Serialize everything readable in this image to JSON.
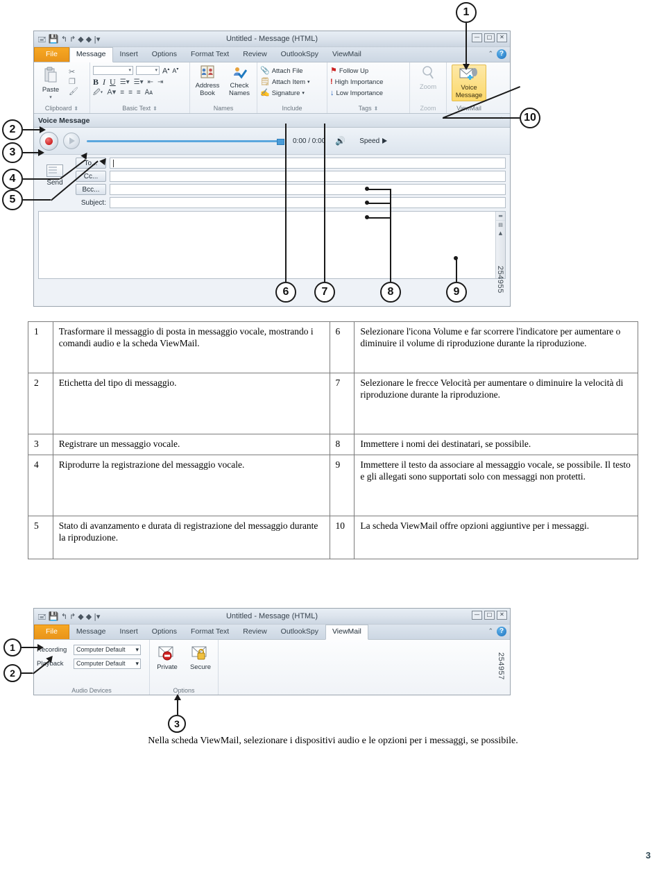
{
  "figure_top": {
    "window_title": "Untitled  -  Message (HTML)",
    "figure_id": "254955",
    "window_buttons": [
      "—",
      "□",
      "✕"
    ],
    "tabs": [
      {
        "label": "File",
        "kind": "file"
      },
      {
        "label": "Message",
        "kind": "active"
      },
      {
        "label": "Insert",
        "kind": "normal"
      },
      {
        "label": "Options",
        "kind": "normal"
      },
      {
        "label": "Format Text",
        "kind": "normal"
      },
      {
        "label": "Review",
        "kind": "normal"
      },
      {
        "label": "OutlookSpy",
        "kind": "normal"
      },
      {
        "label": "ViewMail",
        "kind": "normal"
      }
    ],
    "ribbon_groups": [
      {
        "label": "Clipboard",
        "dialog_launcher": true,
        "paste_label": "Paste"
      },
      {
        "label": "Basic Text",
        "dialog_launcher": true,
        "buttons": [
          "B",
          "I",
          "U"
        ]
      },
      {
        "label": "Names",
        "dialog_launcher": false,
        "items": [
          "Address Book",
          "Check Names"
        ]
      },
      {
        "label": "Include",
        "dialog_launcher": false,
        "items": [
          "Attach File",
          "Attach Item",
          "Signature"
        ]
      },
      {
        "label": "Tags",
        "dialog_launcher": true,
        "items": [
          "Follow Up",
          "High Importance",
          "Low Importance"
        ]
      },
      {
        "label": "Zoom",
        "dialog_launcher": false,
        "items": [
          "Zoom"
        ]
      },
      {
        "label": "ViewMail",
        "dialog_launcher": false,
        "items": [
          "Voice Message"
        ]
      }
    ],
    "voice_bar": {
      "title": "Voice Message",
      "collapse_icon": "chevron-double-up",
      "time": "0:00 / 0:00",
      "speed_label": "Speed"
    },
    "compose": {
      "send_label": "Send",
      "to_label": "To...",
      "cc_label": "Cc...",
      "bcc_label": "Bcc...",
      "subject_label": "Subject:",
      "to_value": "",
      "cc_value": "",
      "bcc_value": "",
      "subject_value": ""
    },
    "callouts": [
      "1",
      "2",
      "3",
      "4",
      "5",
      "6",
      "7",
      "8",
      "9",
      "10"
    ]
  },
  "reference_table": {
    "rows": [
      {
        "left_num": "1",
        "left_text": "Trasformare il messaggio di posta in messaggio vocale, mostrando i comandi audio e la scheda ViewMail.",
        "right_num": "6",
        "right_text": "Selezionare l'icona Volume e far scorrere l'indicatore per aumentare o diminuire il volume di riproduzione durante la riproduzione."
      },
      {
        "left_num": "2",
        "left_text": "Etichetta del tipo di messaggio.",
        "right_num": "7",
        "right_text": "Selezionare le frecce Velocità per aumentare o diminuire la velocità di riproduzione durante la riproduzione."
      },
      {
        "left_num": "3",
        "left_text": "Registrare un messaggio vocale.",
        "right_num": "8",
        "right_text": "Immettere i nomi dei destinatari, se possibile."
      },
      {
        "left_num": "4",
        "left_text": "Riprodurre la registrazione del messaggio vocale.",
        "right_num": "9",
        "right_text": "Immettere il testo da associare al messaggio vocale, se possibile. Il testo e gli allegati sono supportati solo con messaggi non protetti."
      },
      {
        "left_num": "5",
        "left_text": "Stato di avanzamento e durata di registrazione del messaggio durante la riproduzione.",
        "right_num": "10",
        "right_text": "La scheda ViewMail offre opzioni aggiuntive per i messaggi."
      }
    ]
  },
  "figure_bottom": {
    "window_title": "Untitled  -  Message (HTML)",
    "figure_id": "254957",
    "tabs": [
      {
        "label": "File",
        "kind": "file"
      },
      {
        "label": "Message",
        "kind": "normal"
      },
      {
        "label": "Insert",
        "kind": "normal"
      },
      {
        "label": "Options",
        "kind": "normal"
      },
      {
        "label": "Format Text",
        "kind": "normal"
      },
      {
        "label": "Review",
        "kind": "normal"
      },
      {
        "label": "OutlookSpy",
        "kind": "normal"
      },
      {
        "label": "ViewMail",
        "kind": "active"
      }
    ],
    "audio_devices": {
      "group_label": "Audio Devices",
      "recording_label": "Recording",
      "playback_label": "Playback",
      "recording_value": "Computer Default",
      "playback_value": "Computer Default"
    },
    "options_group": {
      "group_label": "Options",
      "private_label": "Private",
      "secure_label": "Secure"
    },
    "callouts": [
      "1",
      "2",
      "3"
    ]
  },
  "bottom_caption": "Nella scheda ViewMail, selezionare i dispositivi audio e le opzioni per i messaggi, se possibile.",
  "page_number": "3",
  "colors": {
    "file_tab": "#f0a020",
    "voice_message_highlight": "#fcd86a",
    "track": "#5aa7dd",
    "record_dot": "#c00000",
    "page_number": "#2d4752"
  }
}
